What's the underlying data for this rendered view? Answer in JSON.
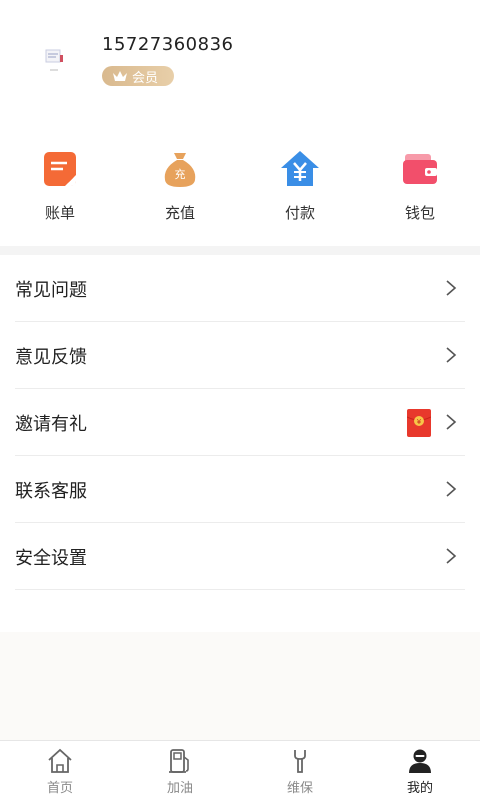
{
  "profile": {
    "phone": "15727360836",
    "member_badge": "会员"
  },
  "quick_actions": [
    {
      "label": "账单",
      "icon": "bill-icon",
      "color": "#f46a36"
    },
    {
      "label": "充值",
      "icon": "money-bag-icon",
      "color": "#e7a25c"
    },
    {
      "label": "付款",
      "icon": "payment-house-icon",
      "color": "#3a8ee6"
    },
    {
      "label": "钱包",
      "icon": "wallet-icon",
      "color": "#f24f6b"
    }
  ],
  "menu": [
    {
      "label": "常见问题"
    },
    {
      "label": "意见反馈"
    },
    {
      "label": "邀请有礼"
    },
    {
      "label": "联系客服"
    },
    {
      "label": "安全设置"
    }
  ],
  "tabs": [
    {
      "label": "首页",
      "icon": "home-icon"
    },
    {
      "label": "加油",
      "icon": "fuel-pump-icon"
    },
    {
      "label": "维保",
      "icon": "wrench-icon"
    },
    {
      "label": "我的",
      "icon": "user-icon",
      "active": true
    }
  ],
  "colors": {
    "badge_gold": "#d9b98e",
    "separator": "#f4f4f4"
  }
}
